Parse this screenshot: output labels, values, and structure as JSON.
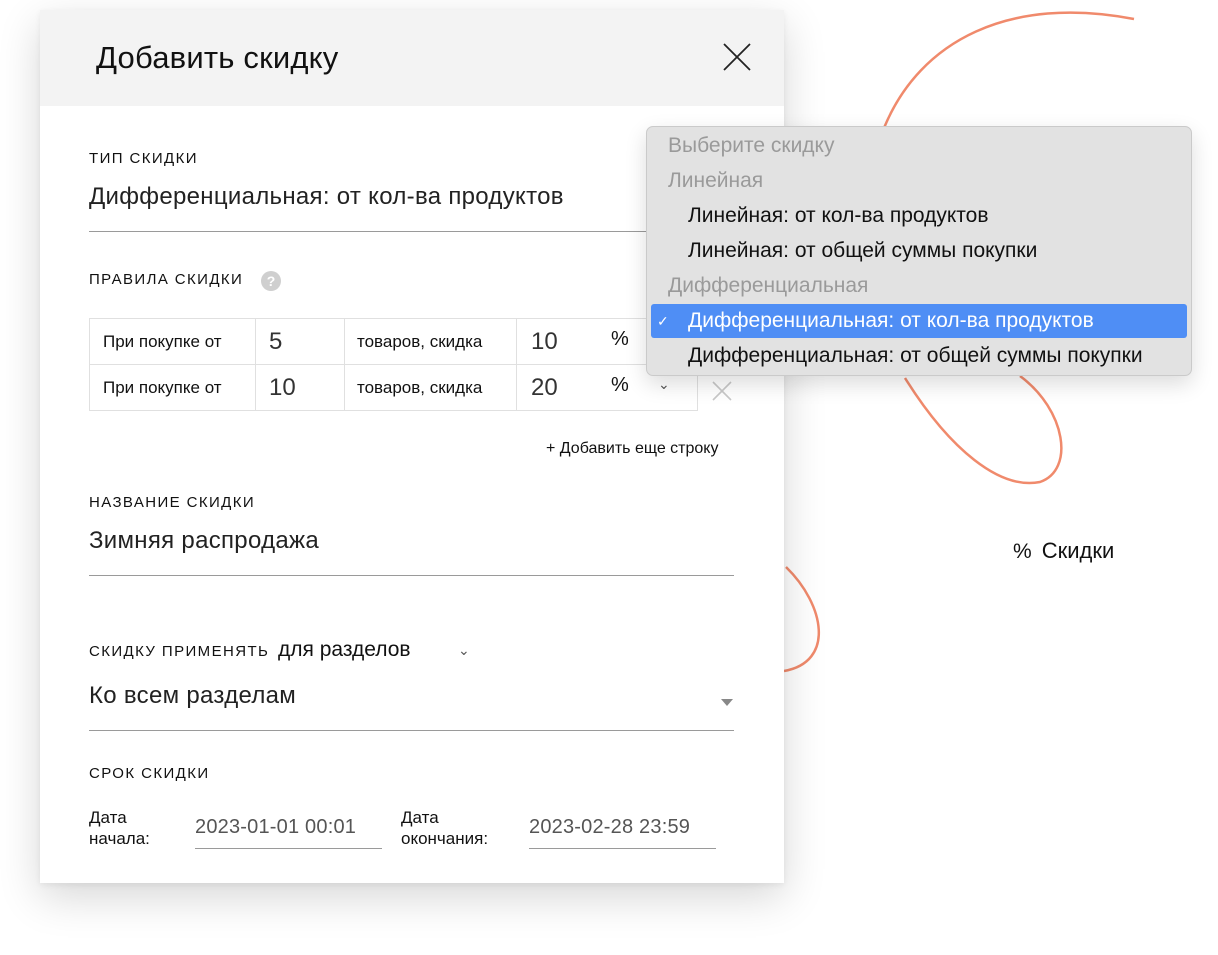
{
  "modal": {
    "title": "Добавить скидку",
    "discount_type": {
      "label": "ТИП СКИДКИ",
      "value": "Дифференциальная: от кол-ва продуктов"
    },
    "rules": {
      "label": "ПРАВИЛА СКИДКИ",
      "help_icon": "?",
      "rows": [
        {
          "prefix": "При покупке от",
          "quantity": "5",
          "middle": "товаров, скидка",
          "discount": "10",
          "unit": "%"
        },
        {
          "prefix": "При покупке от",
          "quantity": "10",
          "middle": "товаров, скидка",
          "discount": "20",
          "unit": "%",
          "chevron": "⌄"
        }
      ],
      "add_row": "+ Добавить еще строку"
    },
    "discount_name": {
      "label": "НАЗВАНИЕ СКИДКИ",
      "value": "Зимняя распродажа"
    },
    "apply": {
      "label": "СКИДКУ ПРИМЕНЯТЬ",
      "mode": "для разделов",
      "chevron": "⌄",
      "value": "Ко всем разделам"
    },
    "period": {
      "label": "СРОК СКИДКИ",
      "start_label_1": "Дата",
      "start_label_2": "начала:",
      "start_value": "2023-01-01 00:01",
      "end_label_1": "Дата",
      "end_label_2": "окончания:",
      "end_value": "2023-02-28 23:59"
    }
  },
  "dropdown": {
    "items": [
      {
        "text": "Выберите скидку",
        "kind": "group"
      },
      {
        "text": "Линейная",
        "kind": "group"
      },
      {
        "text": "Линейная: от кол-ва продуктов",
        "kind": "option"
      },
      {
        "text": "Линейная: от общей суммы покупки",
        "kind": "option"
      },
      {
        "text": "Дифференциальная",
        "kind": "group"
      },
      {
        "text": "Дифференциальная: от кол-ва продуктов",
        "kind": "selected"
      },
      {
        "text": "Дифференциальная: от общей суммы покупки",
        "kind": "option"
      }
    ],
    "check": "✓",
    "selected_color": "#4f8ef5"
  },
  "side_badge": {
    "icon": "%",
    "label": "Скидки"
  },
  "colors": {
    "accent_curve": "#f08a6c",
    "header_bg": "#f3f3f3"
  }
}
